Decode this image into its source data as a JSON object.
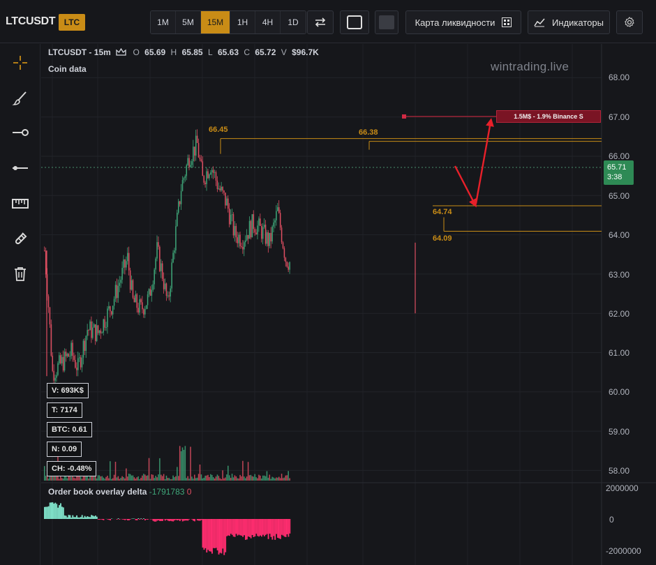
{
  "header": {
    "symbol": "LTCUSDT",
    "coin_badge": "LTC",
    "timeframes": [
      "1M",
      "5M",
      "15M",
      "1H",
      "4H",
      "1D"
    ],
    "active_timeframe": "15M",
    "liquidity_map_label": "Карта ликвидности",
    "indicators_label": "Индикаторы"
  },
  "legend": {
    "title": "LTCUSDT - 15m",
    "open_label": "O",
    "open": "65.69",
    "high_label": "H",
    "high": "65.85",
    "low_label": "L",
    "low": "65.63",
    "close_label": "C",
    "close": "65.72",
    "volume_label": "V",
    "volume": "$96.7K",
    "coin_data": "Coin data"
  },
  "watermark": "wintrading.live",
  "price_axis": {
    "ticks": [
      "68.00",
      "67.00",
      "66.00",
      "65.00",
      "64.00",
      "63.00",
      "62.00",
      "61.00",
      "60.00",
      "59.00",
      "58.00"
    ],
    "current_price": "65.71",
    "countdown": "3:38"
  },
  "levels": [
    {
      "label": "66.45",
      "price": 66.45
    },
    {
      "label": "66.38",
      "price": 66.38
    },
    {
      "label": "64.74",
      "price": 64.74
    },
    {
      "label": "64.09",
      "price": 64.09
    }
  ],
  "liquidity_tag": "1.5M$ - 1.9% Binance S",
  "stats": {
    "volume": "V: 693K$",
    "trades": "T: 7174",
    "btc": "BTC: 0.61",
    "n": "N: 0.09",
    "change": "CH: -0.48%"
  },
  "delta": {
    "title": "Order book overlay delta",
    "value": "-1791783",
    "value2": "0",
    "ticks": [
      "2000000",
      "0",
      "-2000000"
    ]
  },
  "colors": {
    "up": "#3fa87a",
    "down": "#e04f62",
    "level": "#c98c16",
    "delta_neg": "#ff2d6f",
    "delta_pos": "#7fe0c8",
    "arrow": "#e8202a"
  },
  "chart_data": {
    "type": "candlestick",
    "x": [
      "",
      "",
      "",
      "",
      "",
      "",
      "",
      "",
      "",
      "",
      "",
      "",
      "",
      "",
      "",
      "",
      "",
      "",
      "",
      "",
      "",
      "",
      "",
      "",
      "",
      "",
      "",
      "",
      "",
      "",
      "",
      "",
      "",
      "",
      "",
      "",
      "",
      "",
      "",
      "",
      "",
      "",
      "",
      "",
      "",
      "",
      "",
      "",
      "",
      "",
      "",
      "",
      "",
      "",
      "",
      "",
      "",
      "",
      "",
      "",
      "",
      "",
      "",
      "",
      "",
      "",
      "",
      "",
      "",
      "",
      "",
      "",
      "",
      "",
      "",
      "",
      "",
      "",
      "",
      "",
      "",
      "",
      "",
      "",
      "",
      "",
      "",
      "",
      "",
      "",
      "",
      "",
      "",
      "",
      "",
      "",
      "",
      "",
      "",
      "",
      "",
      "",
      "",
      "",
      "",
      "",
      "",
      "",
      "",
      "",
      "",
      "",
      "",
      "",
      "",
      "",
      "",
      "",
      "",
      "",
      "",
      "",
      "",
      "",
      "",
      "",
      "",
      "",
      "",
      "",
      "",
      "",
      "",
      "",
      "",
      "",
      "",
      "",
      "",
      "",
      "",
      "",
      "",
      "",
      "",
      "",
      "",
      "",
      "",
      "",
      "",
      "",
      "",
      "",
      "",
      "",
      "",
      "",
      "",
      "",
      "",
      "",
      "",
      "",
      "",
      "",
      "",
      "",
      "",
      "",
      "",
      "",
      "",
      "",
      "",
      "",
      "",
      "",
      "",
      "",
      "",
      "",
      "",
      ""
    ],
    "price_path": [
      {
        "i": 0,
        "p": 63.6
      },
      {
        "i": 3,
        "p": 62.2
      },
      {
        "i": 6,
        "p": 60.5
      },
      {
        "i": 12,
        "p": 60.7
      },
      {
        "i": 20,
        "p": 61.0
      },
      {
        "i": 25,
        "p": 60.6
      },
      {
        "i": 32,
        "p": 61.6
      },
      {
        "i": 40,
        "p": 61.5
      },
      {
        "i": 50,
        "p": 62.2
      },
      {
        "i": 58,
        "p": 63.0
      },
      {
        "i": 62,
        "p": 63.4
      },
      {
        "i": 66,
        "p": 62.3
      },
      {
        "i": 72,
        "p": 62.1
      },
      {
        "i": 78,
        "p": 62.4
      },
      {
        "i": 84,
        "p": 63.6
      },
      {
        "i": 88,
        "p": 63.0
      },
      {
        "i": 92,
        "p": 62.2
      },
      {
        "i": 97,
        "p": 63.8
      },
      {
        "i": 102,
        "p": 65.2
      },
      {
        "i": 108,
        "p": 66.0
      },
      {
        "i": 114,
        "p": 66.3
      },
      {
        "i": 118,
        "p": 65.4
      },
      {
        "i": 124,
        "p": 65.8
      },
      {
        "i": 130,
        "p": 65.2
      },
      {
        "i": 136,
        "p": 64.8
      },
      {
        "i": 142,
        "p": 64.0
      },
      {
        "i": 148,
        "p": 63.9
      },
      {
        "i": 156,
        "p": 64.3
      },
      {
        "i": 162,
        "p": 64.1
      },
      {
        "i": 168,
        "p": 63.8
      },
      {
        "i": 174,
        "p": 64.6
      },
      {
        "i": 180,
        "p": 63.4
      },
      {
        "i": 186,
        "p": 63.2
      },
      {
        "i": 190,
        "p": 63.0
      },
      {
        "i": 196,
        "p": 63.4
      },
      {
        "i": 202,
        "p": 64.2
      },
      {
        "i": 210,
        "p": 64.8
      },
      {
        "i": 218,
        "p": 65.6
      },
      {
        "i": 226,
        "p": 66.2
      },
      {
        "i": 232,
        "p": 66.1
      },
      {
        "i": 238,
        "p": 66.0
      },
      {
        "i": 244,
        "p": 65.6
      },
      {
        "i": 250,
        "p": 65.0
      },
      {
        "i": 256,
        "p": 64.8
      },
      {
        "i": 262,
        "p": 65.4
      },
      {
        "i": 268,
        "p": 64.6
      },
      {
        "i": 272,
        "p": 64.4
      },
      {
        "i": 278,
        "p": 65.4
      },
      {
        "i": 284,
        "p": 65.8
      },
      {
        "i": 288,
        "p": 64.6
      },
      {
        "i": 292,
        "p": 64.4
      },
      {
        "i": 296,
        "p": 65.8
      },
      {
        "i": 300,
        "p": 66.1
      },
      {
        "i": 304,
        "p": 65.7
      }
    ]
  }
}
